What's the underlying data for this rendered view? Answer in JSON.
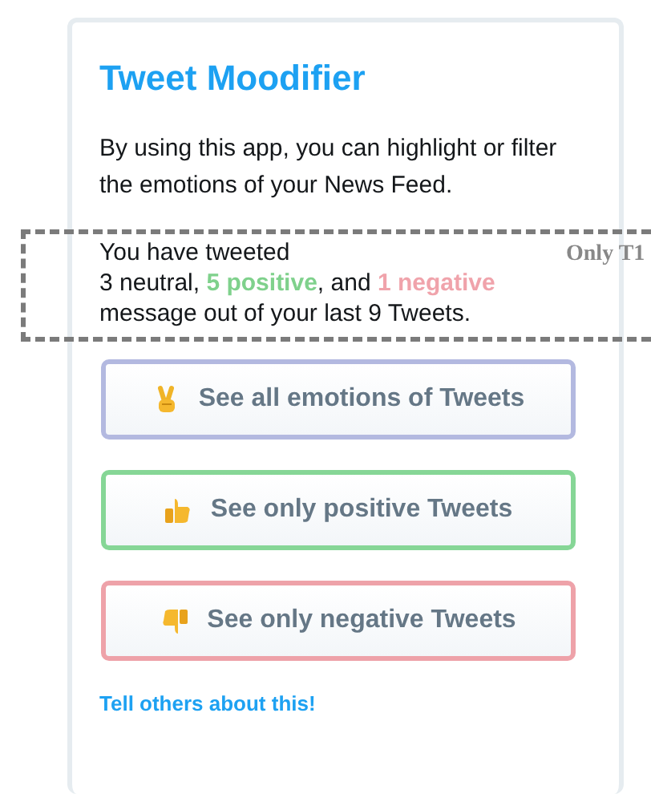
{
  "card": {
    "title": "Tweet Moodifier",
    "description": "By using this app, you can highlight or filter the emotions of your News Feed.",
    "summary": [
      {
        "text": "You have tweeted\n3 neutral, ",
        "kind": "plain"
      },
      {
        "text": "5 positive",
        "kind": "highlight",
        "color": "#7fd18c"
      },
      {
        "text": ", and ",
        "kind": "plain"
      },
      {
        "text": "1 negative",
        "kind": "highlight",
        "color": "#f0a3ab"
      },
      {
        "text": "\nmessage out of your last 9 Tweets.",
        "kind": "plain"
      }
    ],
    "buttons": [
      {
        "label": "See all emotions of Tweets",
        "kind": "victory",
        "color": "#b3b9e0"
      },
      {
        "label": "See only positive Tweets",
        "kind": "thumbs-up",
        "color": "#86d696"
      },
      {
        "label": "See only negative Tweets",
        "kind": "thumbs-down",
        "color": "#eea2a9"
      }
    ],
    "link": "Tell others about this!"
  },
  "annotation": {
    "label": "Only T1"
  }
}
